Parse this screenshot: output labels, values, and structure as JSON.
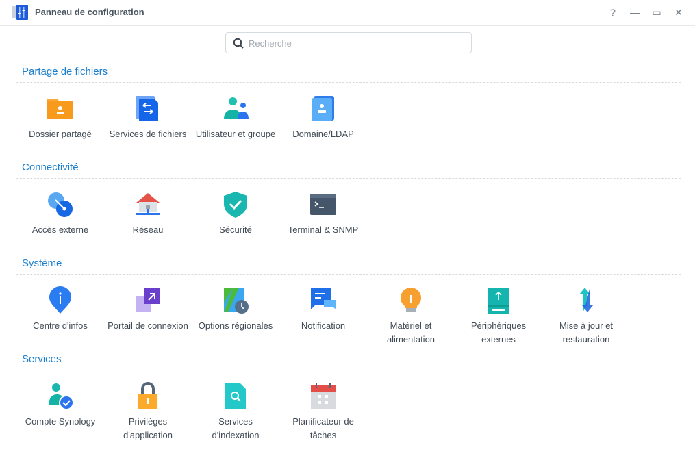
{
  "window": {
    "title": "Panneau de configuration",
    "help": "?",
    "minimize": "—",
    "maximize": "▭",
    "close": "✕"
  },
  "search": {
    "placeholder": "Recherche",
    "value": ""
  },
  "sections": [
    {
      "title": "Partage de fichiers",
      "items": [
        {
          "label": "Dossier partagé",
          "icon": "shared-folder-icon"
        },
        {
          "label": "Services de fichiers",
          "icon": "file-services-icon"
        },
        {
          "label": "Utilisateur et groupe",
          "icon": "user-group-icon"
        },
        {
          "label": "Domaine/LDAP",
          "icon": "domain-ldap-icon"
        }
      ]
    },
    {
      "title": "Connectivité",
      "items": [
        {
          "label": "Accès externe",
          "icon": "external-access-icon"
        },
        {
          "label": "Réseau",
          "icon": "network-icon"
        },
        {
          "label": "Sécurité",
          "icon": "security-shield-icon"
        },
        {
          "label": "Terminal & SNMP",
          "icon": "terminal-icon"
        }
      ]
    },
    {
      "title": "Système",
      "items": [
        {
          "label": "Centre d'infos",
          "icon": "info-center-icon"
        },
        {
          "label": "Portail de connexion",
          "icon": "login-portal-icon"
        },
        {
          "label": "Options régionales",
          "icon": "regional-options-icon"
        },
        {
          "label": "Notification",
          "icon": "notification-icon"
        },
        {
          "label": "Matériel et alimentation",
          "icon": "hardware-power-icon"
        },
        {
          "label": "Périphériques externes",
          "icon": "external-devices-icon"
        },
        {
          "label": "Mise à jour et restauration",
          "icon": "update-restore-icon"
        }
      ]
    },
    {
      "title": "Services",
      "items": [
        {
          "label": "Compte Synology",
          "icon": "synology-account-icon"
        },
        {
          "label": "Privilèges d'application",
          "icon": "app-privileges-icon"
        },
        {
          "label": "Services d'indexation",
          "icon": "indexing-service-icon"
        },
        {
          "label": "Planificateur de tâches",
          "icon": "task-scheduler-icon"
        }
      ]
    }
  ]
}
